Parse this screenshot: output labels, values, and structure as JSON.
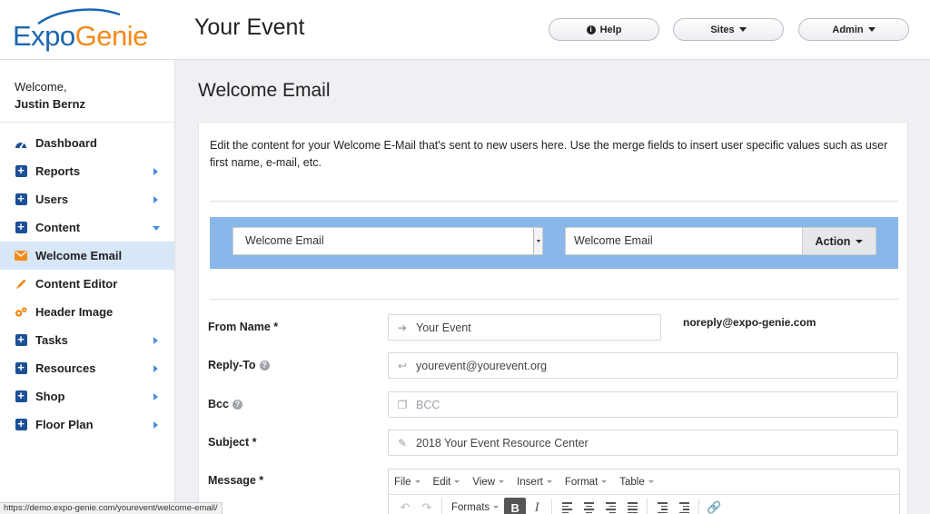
{
  "header": {
    "logo_part1": "Expo",
    "logo_part2": "Genie",
    "event_title": "Your Event",
    "help_label": "Help",
    "sites_label": "Sites",
    "admin_label": "Admin"
  },
  "sidebar": {
    "welcome_text": "Welcome,",
    "user_name": "Justin Bernz",
    "items": [
      {
        "label": "Dashboard",
        "icon": "dashboard-icon"
      },
      {
        "label": "Reports",
        "icon": "plus-icon"
      },
      {
        "label": "Users",
        "icon": "plus-icon"
      },
      {
        "label": "Content",
        "icon": "plus-icon"
      },
      {
        "label": "Welcome Email",
        "icon": "envelope-icon"
      },
      {
        "label": "Content Editor",
        "icon": "pencil-icon"
      },
      {
        "label": "Header Image",
        "icon": "gears-icon"
      },
      {
        "label": "Tasks",
        "icon": "plus-icon"
      },
      {
        "label": "Resources",
        "icon": "plus-icon"
      },
      {
        "label": "Shop",
        "icon": "plus-icon"
      },
      {
        "label": "Floor Plan",
        "icon": "plus-icon"
      }
    ]
  },
  "main": {
    "title": "Welcome Email",
    "description": "Edit the content for your Welcome E-Mail that's sent to new users here. Use the merge fields to insert user specific values such as user first name, e-mail, etc.",
    "template_select_value": "Welcome Email",
    "template_name_value": "Welcome Email",
    "action_label": "Action",
    "form": {
      "from_name_label": "From Name *",
      "from_name_value": "Your Event",
      "from_email": "noreply@expo-genie.com",
      "reply_to_label": "Reply-To",
      "reply_to_value": "yourevent@yourevent.org",
      "bcc_label": "Bcc",
      "bcc_placeholder": "BCC",
      "subject_label": "Subject *",
      "subject_value": "2018 Your Event Resource Center",
      "message_label": "Message *"
    },
    "editor": {
      "menus": [
        "File",
        "Edit",
        "View",
        "Insert",
        "Format",
        "Table"
      ],
      "formats_label": "Formats",
      "bold_label": "B",
      "italic_label": "I"
    }
  },
  "status_url": "https://demo.expo-genie.com/yourevent/welcome-email/"
}
